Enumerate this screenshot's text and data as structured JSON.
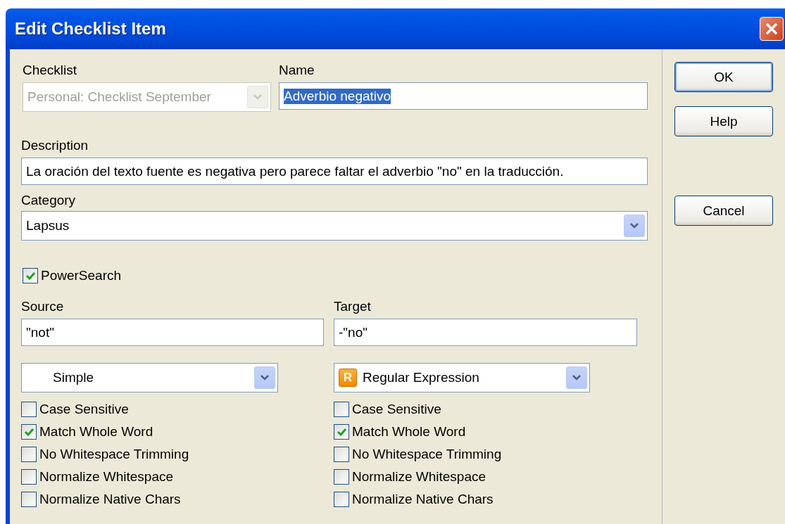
{
  "window": {
    "title": "Edit Checklist Item"
  },
  "checklist": {
    "label": "Checklist",
    "value": "Personal: Checklist September",
    "disabled": true
  },
  "name": {
    "label": "Name",
    "value": "Adverbio negativo",
    "selected": true
  },
  "description": {
    "label": "Description",
    "value": "La oración del texto fuente es negativa pero parece faltar el adverbio \"no\" en la traducción."
  },
  "category": {
    "label": "Category",
    "value": "Lapsus",
    "disabled": false
  },
  "power_search": {
    "label": "PowerSearch",
    "checked": true
  },
  "source": {
    "label": "Source",
    "value": "\"not\"",
    "mode": {
      "kind": "plain",
      "value": "Simple"
    },
    "options": [
      {
        "label": "Case Sensitive",
        "checked": false
      },
      {
        "label": "Match Whole Word",
        "checked": true
      },
      {
        "label": "No Whitespace Trimming",
        "checked": false
      },
      {
        "label": "Normalize Whitespace",
        "checked": false
      },
      {
        "label": "Normalize Native Chars",
        "checked": false
      }
    ]
  },
  "target": {
    "label": "Target",
    "value": "-\"no\"",
    "mode": {
      "kind": "badge",
      "badge": "R",
      "value": "Regular Expression"
    },
    "options": [
      {
        "label": "Case Sensitive",
        "checked": false
      },
      {
        "label": "Match Whole Word",
        "checked": true
      },
      {
        "label": "No Whitespace Trimming",
        "checked": false
      },
      {
        "label": "Normalize Whitespace",
        "checked": false
      },
      {
        "label": "Normalize Native Chars",
        "checked": false
      }
    ]
  },
  "buttons": [
    {
      "label": "OK",
      "default": true
    },
    {
      "label": "Help",
      "default": false
    },
    {
      "label": "Cancel",
      "default": false
    }
  ]
}
